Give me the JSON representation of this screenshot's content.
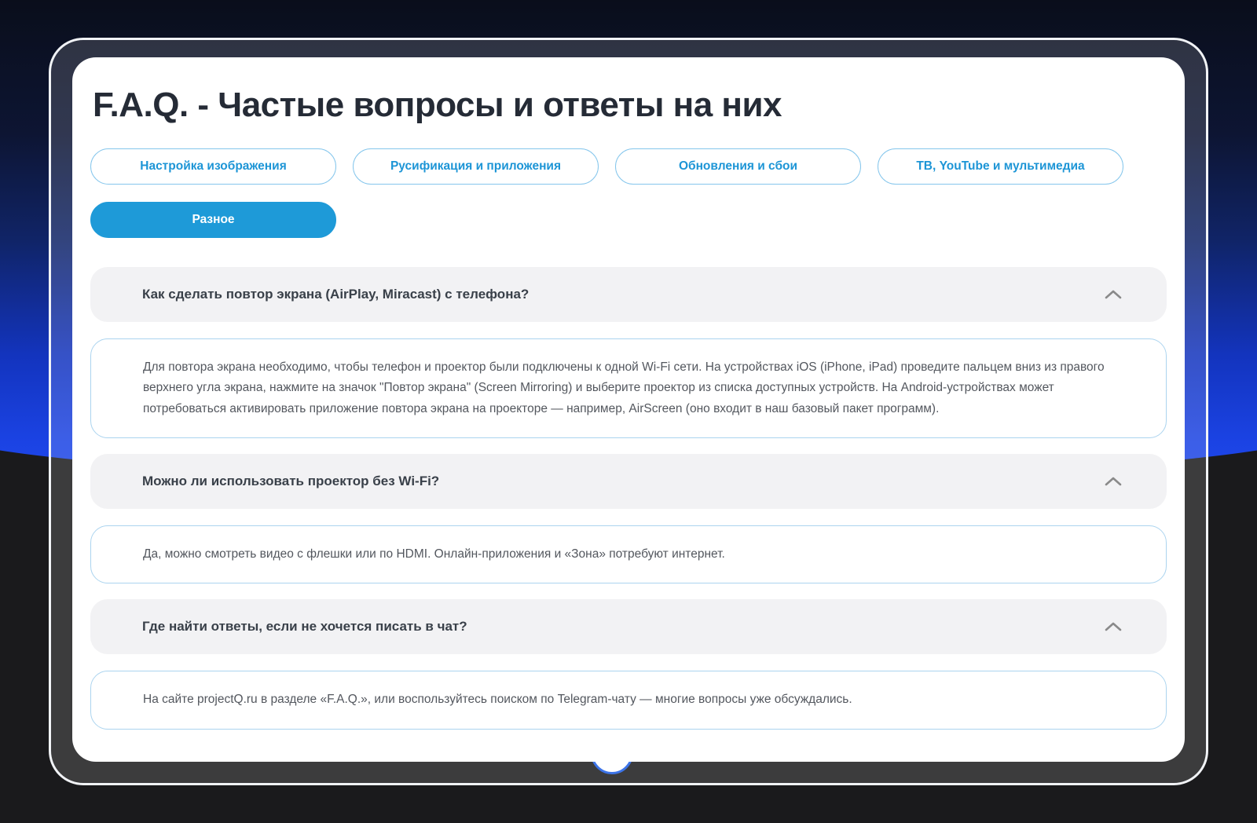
{
  "page": {
    "title": "F.A.Q. - Частые вопросы и ответы на них"
  },
  "categories": [
    {
      "label": "Настройка изображения",
      "active": false
    },
    {
      "label": "Русификация и приложения",
      "active": false
    },
    {
      "label": "Обновления и сбои",
      "active": false
    },
    {
      "label": "ТВ, YouTube и мультимедиа",
      "active": false
    },
    {
      "label": "Разное",
      "active": true
    }
  ],
  "faq": [
    {
      "question": "Как сделать повтор экрана (AirPlay, Miracast) с телефона?",
      "expanded": true,
      "answer": "Для повтора экрана необходимо, чтобы телефон и проектор были подключены к одной Wi-Fi сети. На устройствах iOS (iPhone, iPad) проведите пальцем вниз из правого верхнего угла экрана, нажмите на значок \"Повтор экрана\" (Screen Mirroring) и выберите проектор из списка доступных устройств. На Android-устройствах может потребоваться активировать приложение повтора экрана на проекторе — например, AirScreen (оно входит в наш базовый пакет программ)."
    },
    {
      "question": "Можно ли использовать проектор без Wi-Fi?",
      "expanded": true,
      "answer": "Да, можно смотреть видео с флешки или по HDMI. Онлайн-приложения и «Зона» потребуют интернет."
    },
    {
      "question": "Где найти ответы, если не хочется писать в чат?",
      "expanded": true,
      "answer": "На сайте projectQ.ru в разделе «F.A.Q.», или воспользуйтесь поиском по Telegram-чату — многие вопросы уже обсуждались."
    }
  ],
  "colors": {
    "accent_blue": "#1e9ad8",
    "pill_border": "#85c6ec",
    "pill_text": "#1d95d6",
    "answer_border": "#abd4ef",
    "question_bg": "#f2f2f4",
    "backdrop_blue": "#1e47ea",
    "backdrop_black": "#1a1a1c",
    "peek_ring_blue": "#3d74e8"
  }
}
